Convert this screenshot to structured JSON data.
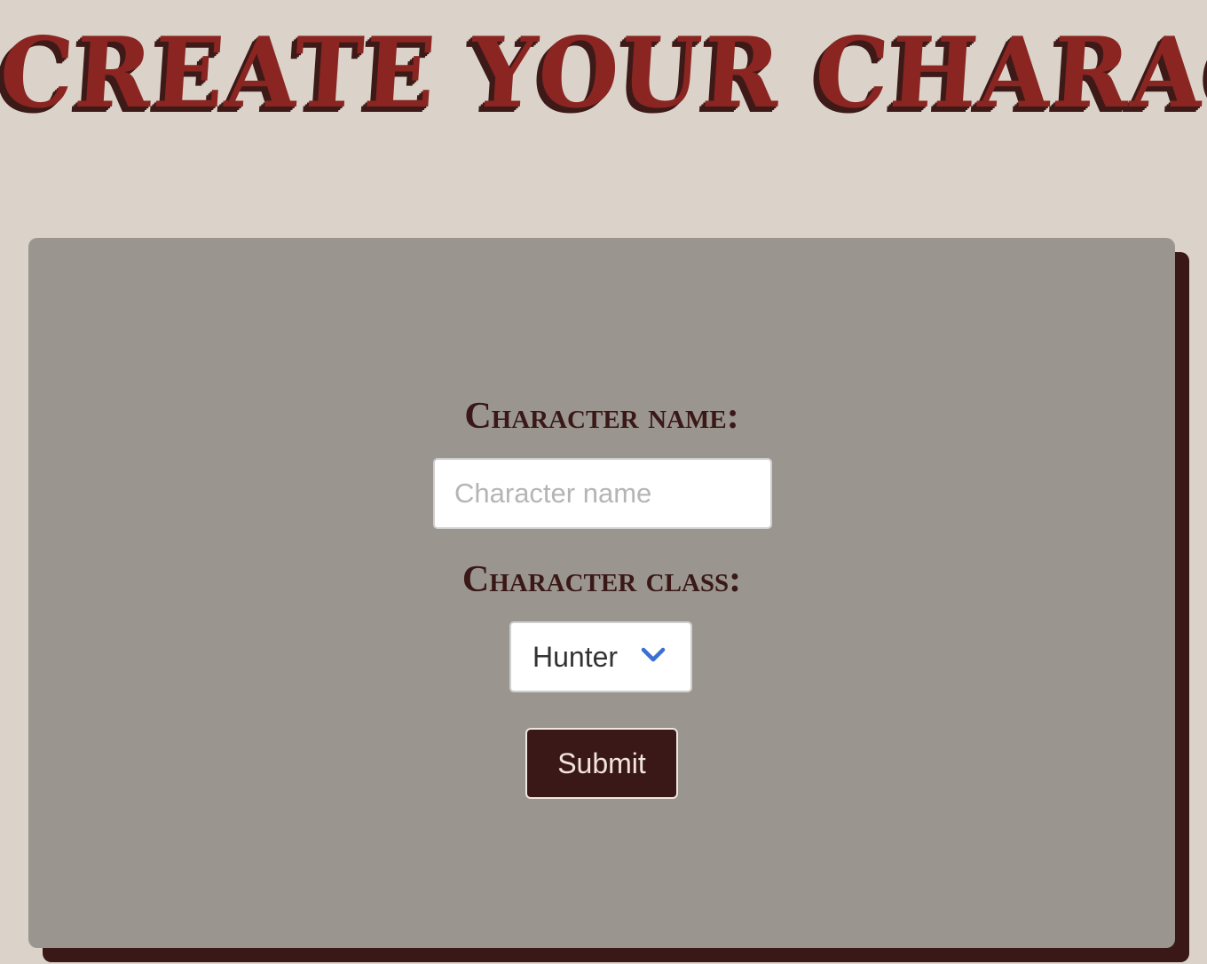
{
  "header": {
    "title": "Create Your Character"
  },
  "form": {
    "name_label": "Character name:",
    "name_placeholder": "Character name",
    "name_value": "",
    "class_label": "Character class:",
    "class_selected": "Hunter",
    "submit_label": "Submit"
  },
  "icons": {
    "select_arrow": "chevron-down-icon"
  },
  "colors": {
    "page_background": "#dbd3c9",
    "title": "#8a2522",
    "title_shadow": "#3d1a18",
    "card_background": "#9a968f",
    "card_shadow": "#3a1817",
    "label_text": "#3a1817",
    "button_background": "#3a1817",
    "select_arrow": "#3b6fd4"
  }
}
